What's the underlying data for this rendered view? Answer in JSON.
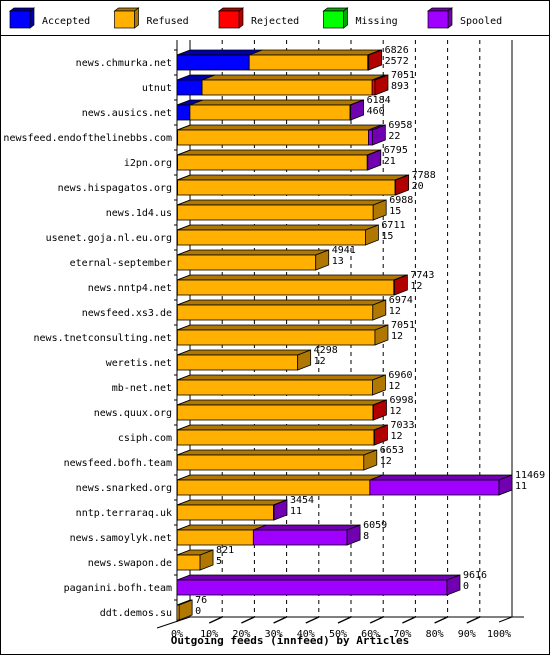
{
  "chart_data": {
    "type": "bar",
    "orientation": "horizontal",
    "stacked": true,
    "style": "3d",
    "title": "Outgoing feeds (innfeed) by Articles",
    "xlabel": "Outgoing feeds (innfeed) by Articles",
    "ylabel": "",
    "xlim": [
      0,
      100
    ],
    "x_unit": "%",
    "x_ticks": [
      "0%",
      "10%",
      "20%",
      "30%",
      "40%",
      "50%",
      "60%",
      "70%",
      "80%",
      "90%",
      "100%"
    ],
    "grid": true,
    "legend_position": "top",
    "legend": [
      {
        "name": "Accepted",
        "color": "#0000ff",
        "side_color": "#0000a8"
      },
      {
        "name": "Refused",
        "color": "#ffb000",
        "side_color": "#b07800"
      },
      {
        "name": "Rejected",
        "color": "#ff0000",
        "side_color": "#b00000"
      },
      {
        "name": "Missing",
        "color": "#00ff00",
        "side_color": "#00a800"
      },
      {
        "name": "Spooled",
        "color": "#a000ff",
        "side_color": "#7000b0"
      }
    ],
    "max_total": 11469,
    "categories": [
      "news.chmurka.net",
      "utnut",
      "news.ausics.net",
      "newsfeed.endofthelinebbs.com",
      "i2pn.org",
      "news.hispagatos.org",
      "news.1d4.us",
      "usenet.goja.nl.eu.org",
      "eternal-september",
      "news.nntp4.net",
      "newsfeed.xs3.de",
      "news.tnetconsulting.net",
      "weretis.net",
      "mb-net.net",
      "news.quux.org",
      "csiph.com",
      "newsfeed.bofh.team",
      "news.snarked.org",
      "nntp.terraraq.uk",
      "news.samoylyk.net",
      "news.swapon.de",
      "paganini.bofh.team",
      "ddt.demos.su"
    ],
    "totals": [
      6826,
      7051,
      6184,
      6958,
      6795,
      7788,
      6988,
      6711,
      4941,
      7743,
      6974,
      7051,
      4298,
      6960,
      6998,
      7033,
      6653,
      11469,
      3454,
      6059,
      821,
      9616,
      76
    ],
    "accepted": [
      2572,
      893,
      460,
      22,
      21,
      20,
      15,
      15,
      13,
      12,
      12,
      12,
      12,
      12,
      12,
      12,
      12,
      11,
      11,
      8,
      5,
      0,
      0
    ],
    "series": [
      {
        "name": "Accepted",
        "values": [
          2572,
          893,
          460,
          22,
          21,
          20,
          15,
          15,
          13,
          12,
          12,
          12,
          12,
          12,
          12,
          12,
          12,
          11,
          11,
          8,
          5,
          0,
          0
        ]
      },
      {
        "name": "Refused",
        "values": [
          4224,
          6058,
          5704,
          6796,
          6754,
          7748,
          6973,
          6696,
          4928,
          7711,
          6962,
          7039,
          4286,
          6948,
          6966,
          7001,
          6641,
          6858,
          3423,
          2711,
          816,
          0,
          76
        ]
      },
      {
        "name": "Rejected",
        "values": [
          30,
          100,
          0,
          0,
          0,
          20,
          0,
          0,
          0,
          20,
          0,
          0,
          0,
          0,
          20,
          20,
          0,
          0,
          0,
          0,
          0,
          0,
          0
        ]
      },
      {
        "name": "Missing",
        "values": [
          0,
          0,
          0,
          0,
          0,
          0,
          0,
          0,
          0,
          0,
          0,
          0,
          0,
          0,
          0,
          0,
          0,
          0,
          0,
          0,
          0,
          0,
          0
        ]
      },
      {
        "name": "Spooled",
        "values": [
          0,
          0,
          20,
          140,
          20,
          0,
          0,
          0,
          0,
          0,
          0,
          0,
          0,
          0,
          0,
          0,
          0,
          4600,
          20,
          3340,
          0,
          9616,
          0
        ]
      }
    ]
  }
}
